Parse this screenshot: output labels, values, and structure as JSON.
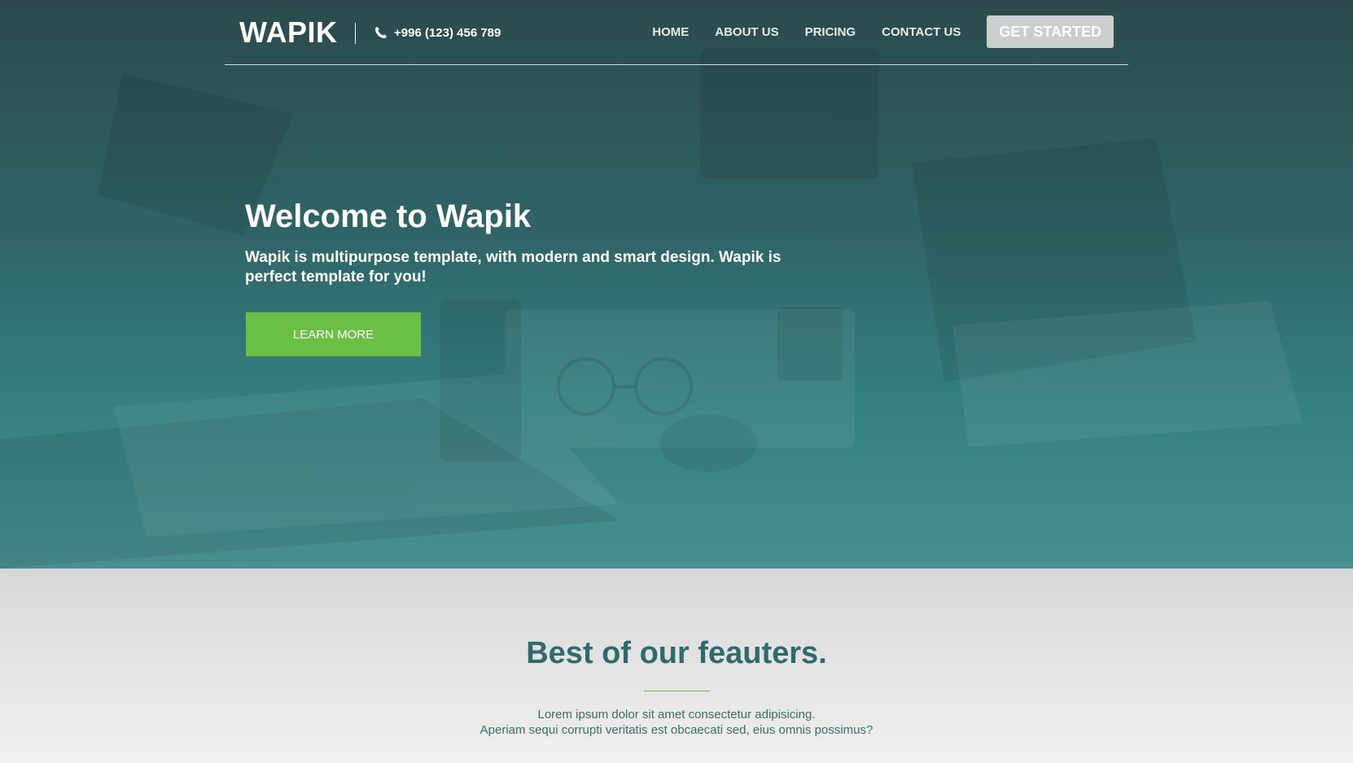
{
  "header": {
    "logo": "WAPIK",
    "phone": "+996 (123) 456 789",
    "phone_icon": "phone-icon",
    "nav": [
      "HOME",
      "ABOUT US",
      "PRICING",
      "CONTACT US"
    ],
    "cta": "GET STARTED"
  },
  "hero": {
    "title": "Welcome to Wapik",
    "subtitle": "Wapik is multipurpose template, with modern and smart design. Wapik is perfect template for you!",
    "button": "LEARN MORE"
  },
  "features": {
    "title": "Best of our feauters.",
    "text_line1": "Lorem ipsum dolor sit amet consectetur adipisicing.",
    "text_line2": "Aperiam sequi corrupti veritatis est obcaecati sed, eius omnis possimus?"
  },
  "colors": {
    "accent_green": "#6bbf42",
    "teal_dark": "#2c4a4c",
    "teal_heading": "#2f6a6c"
  }
}
